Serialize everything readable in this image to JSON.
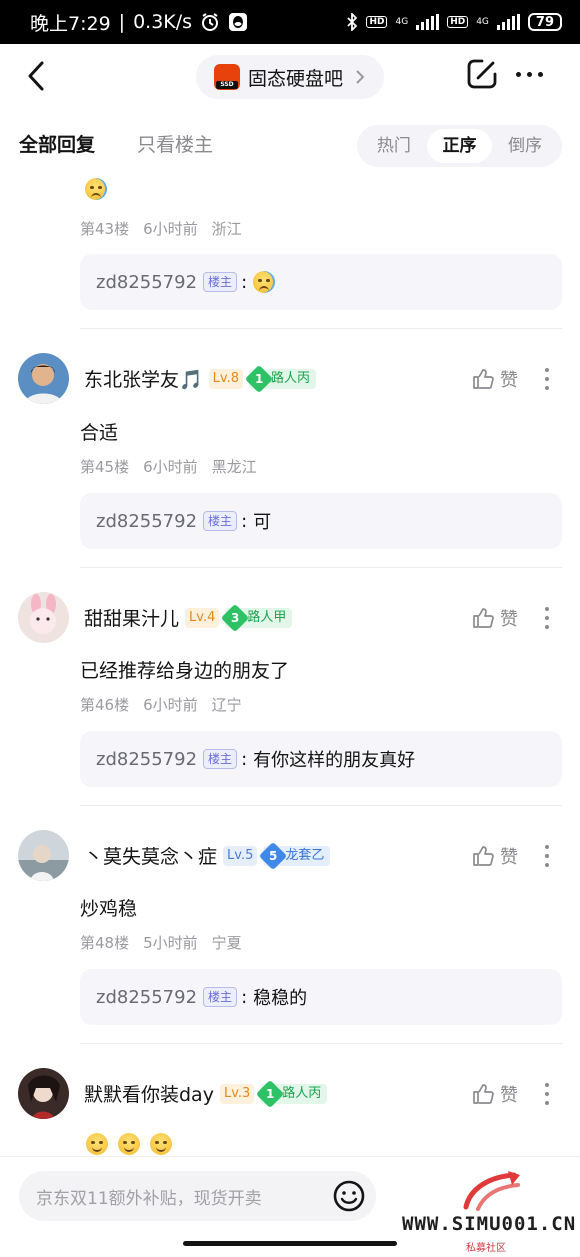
{
  "status_bar": {
    "time": "晚上7:29",
    "speed": "0.3K/s",
    "network_left": "4G",
    "network_right": "4G",
    "battery": "79"
  },
  "header": {
    "forum_name": "固态硬盘吧",
    "forum_logo_text": "SSD",
    "back_icon": "chevron-left-icon",
    "edit_icon": "edit-icon",
    "more_icon": "more-horizontal-icon"
  },
  "tabs": {
    "all_replies": "全部回复",
    "op_only": "只看楼主",
    "sort": [
      "热门",
      "正序",
      "倒序"
    ],
    "active_sort": "正序"
  },
  "partial_post": {
    "floor": "第43楼",
    "time": "6小时前",
    "location": "浙江",
    "reply": {
      "user": "zd8255792",
      "badge": "楼主",
      "text": ""
    }
  },
  "posts": [
    {
      "username": "东北张学友🎵",
      "level": "Lv.8",
      "level_color": "#e58a1c",
      "title_num": "1",
      "title": "路人丙",
      "title_color": "#2ec267",
      "content": "合适",
      "floor": "第45楼",
      "time": "6小时前",
      "location": "黑龙江",
      "like_label": "赞",
      "reply": {
        "user": "zd8255792",
        "badge": "楼主",
        "text": "可"
      }
    },
    {
      "username": "甜甜果汁儿",
      "level": "Lv.4",
      "level_color": "#e58a1c",
      "title_num": "3",
      "title": "路人甲",
      "title_color": "#2ec267",
      "content": "已经推荐给身边的朋友了",
      "floor": "第46楼",
      "time": "6小时前",
      "location": "辽宁",
      "like_label": "赞",
      "reply": {
        "user": "zd8255792",
        "badge": "楼主",
        "text": "有你这样的朋友真好"
      }
    },
    {
      "username": "丶莫失莫念丶症",
      "level": "Lv.5",
      "level_color": "#4d7ad9",
      "title_num": "5",
      "title": "龙套乙",
      "title_color": "#3f88e8",
      "content": "炒鸡稳",
      "floor": "第48楼",
      "time": "5小时前",
      "location": "宁夏",
      "like_label": "赞",
      "reply": {
        "user": "zd8255792",
        "badge": "楼主",
        "text": "稳稳的"
      }
    },
    {
      "username": "默默看你装day",
      "level": "Lv.3",
      "level_color": "#e58a1c",
      "title_num": "1",
      "title": "路人丙",
      "title_color": "#2ec267",
      "content": "",
      "like_label": "赞"
    }
  ],
  "bottom": {
    "input_placeholder": "京东双11额外补贴，现货开卖",
    "watermark": "WWW.SIMU001.CN",
    "watermark_sub": "私募社区"
  }
}
